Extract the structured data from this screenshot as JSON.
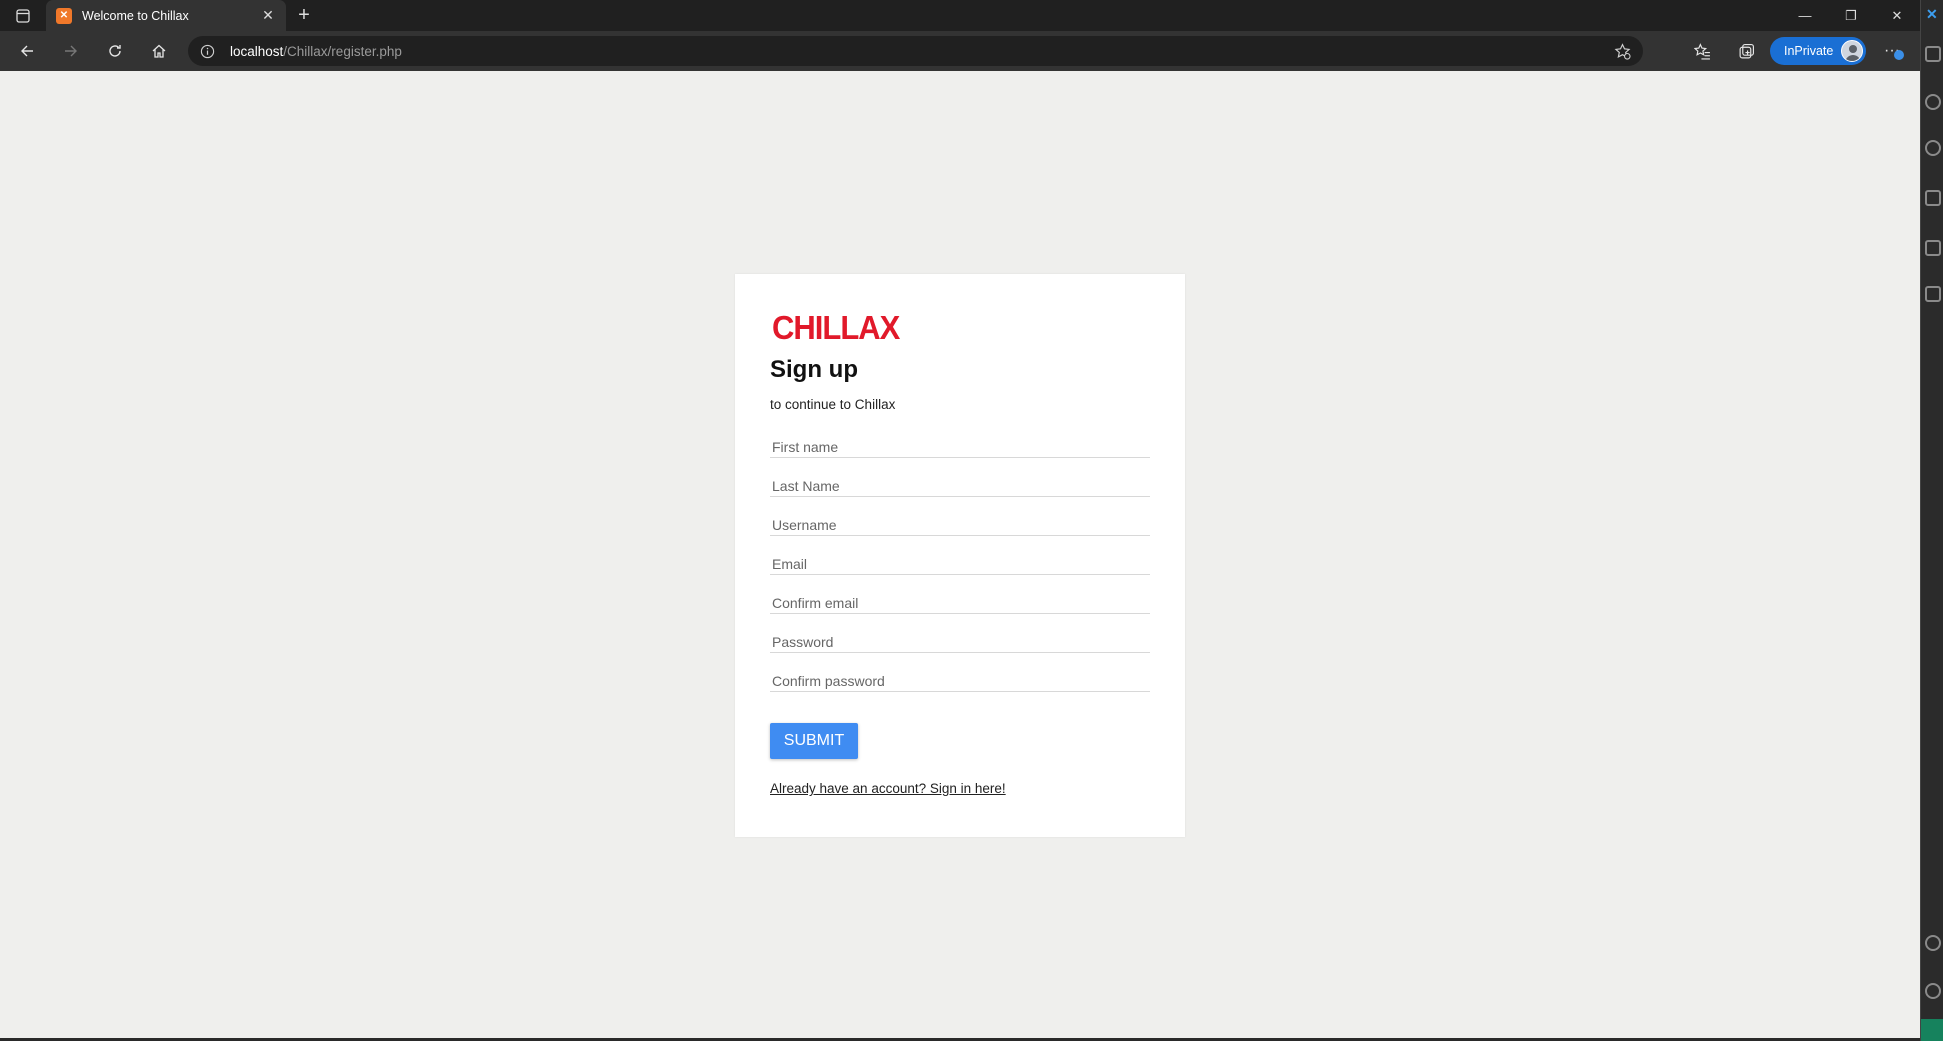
{
  "browser": {
    "tab_title": "Welcome to Chillax",
    "url_host": "localhost",
    "url_path": "/Chillax/register.php",
    "inprivate_label": "InPrivate"
  },
  "page": {
    "logo_text": "CHILLAX",
    "title": "Sign up",
    "subtitle": "to continue to Chillax",
    "fields": {
      "first_name": "First name",
      "last_name": "Last Name",
      "username": "Username",
      "email": "Email",
      "confirm_email": "Confirm email",
      "password": "Password",
      "confirm_password": "Confirm password"
    },
    "submit_label": "SUBMIT",
    "signin_link": "Already have an account? Sign in here!"
  },
  "colors": {
    "brand_red": "#e1192a",
    "submit_blue": "#3f8cf2",
    "page_bg": "#efefed"
  }
}
